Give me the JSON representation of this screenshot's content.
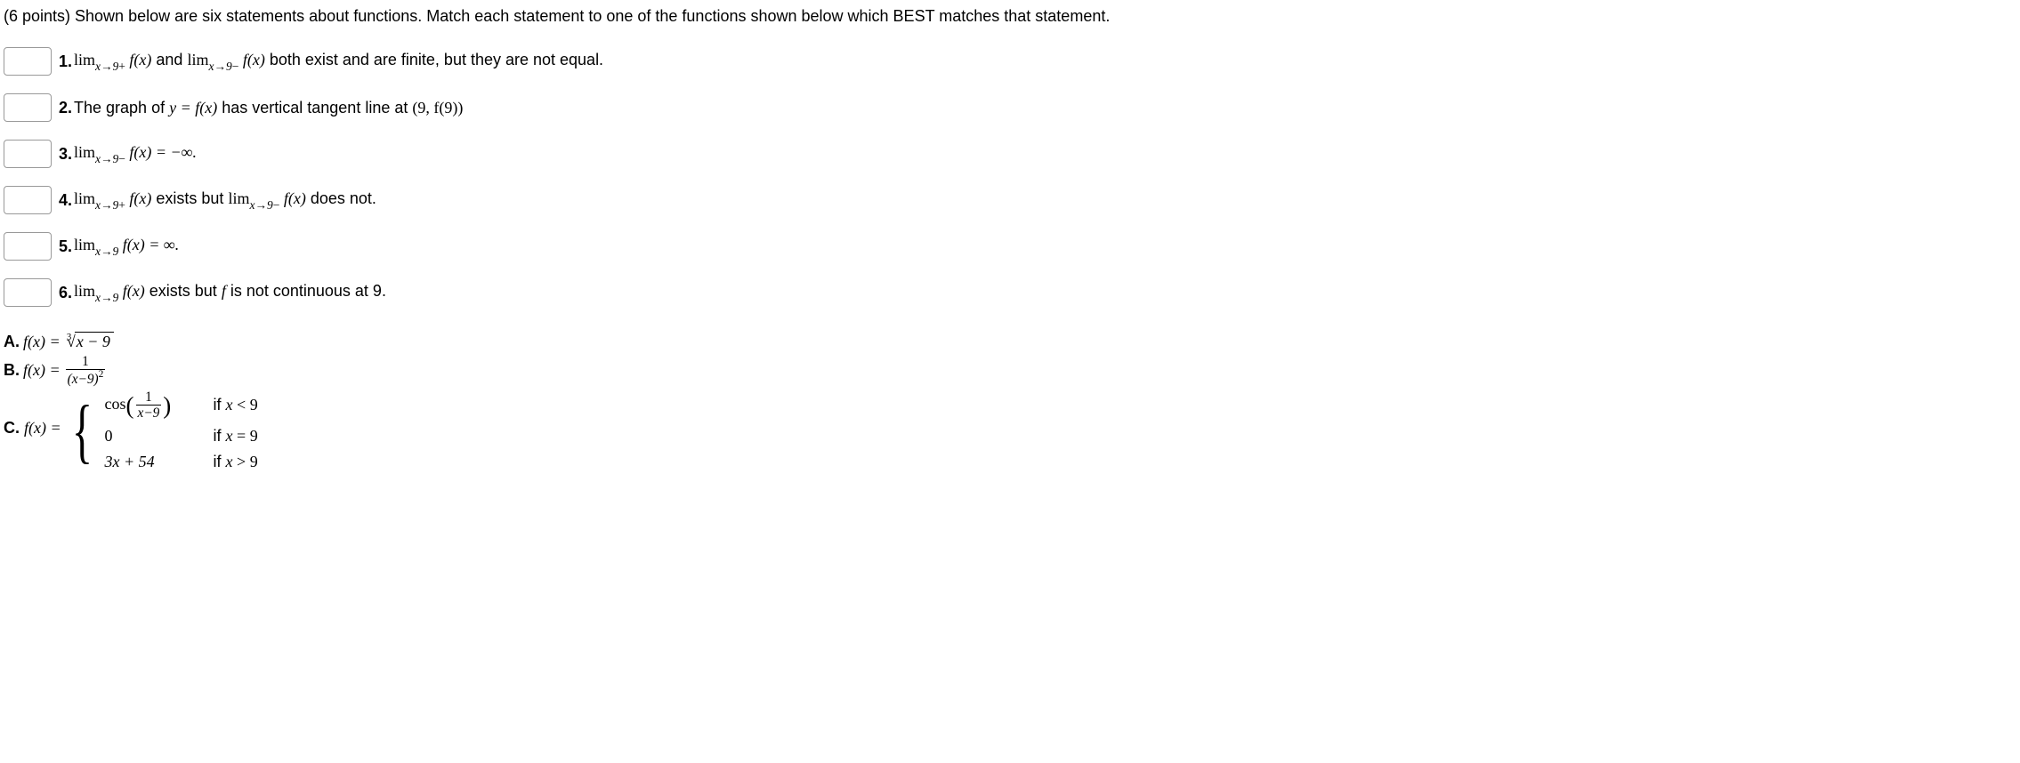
{
  "intro": "(6 points) Shown below are six statements about functions. Match each statement to one of the functions shown below which BEST matches that statement.",
  "statements": {
    "s1": {
      "num": "1.",
      "pre": "lim",
      "sub1": "x→9",
      "sup1": "+",
      "fx": " f(x)",
      "mid": " and ",
      "sub2": "x→9",
      "sup2": "−",
      "post": " both exist and are finite, but they are not equal."
    },
    "s2": {
      "num": "2.",
      "pre": " The graph of ",
      "eq1": "y = f(x)",
      "mid": " has vertical tangent line at ",
      "eq2": "(9, f(9))"
    },
    "s3": {
      "num": "3.",
      "pre": "lim",
      "sub": "x→9",
      "sup": "−",
      "fx": " f(x) = −∞.",
      "post": ""
    },
    "s4": {
      "num": "4.",
      "pre": "lim",
      "sub1": "x→9",
      "sup1": "+",
      "fx": " f(x)",
      "mid": " exists but ",
      "sub2": "x→9",
      "sup2": "−",
      "post": " does not."
    },
    "s5": {
      "num": "5.",
      "pre": "lim",
      "sub": "x→9",
      "fx": " f(x) = ∞."
    },
    "s6": {
      "num": "6.",
      "pre": "lim",
      "sub": "x→9",
      "fx": " f(x)",
      "mid": " exists but ",
      "fvar": "f",
      "post": " is not continuous at 9."
    }
  },
  "options": {
    "a": {
      "label": "A.",
      "lhs": " f(x) = ",
      "rootidx": "3",
      "radicand": "x − 9"
    },
    "b": {
      "label": "B.",
      "lhs": " f(x) = ",
      "num": "1",
      "den_base": "(x−9)",
      "den_exp": "2"
    },
    "c": {
      "label": "C.",
      "lhs": " f(x) = ",
      "p1_cos": "cos",
      "p1_num": "1",
      "p1_den": "x−9",
      "p1_cond": "if x < 9",
      "p2_expr": "0",
      "p2_cond": "if x = 9",
      "p3_expr": "3x + 54",
      "p3_cond": "if x > 9"
    }
  }
}
